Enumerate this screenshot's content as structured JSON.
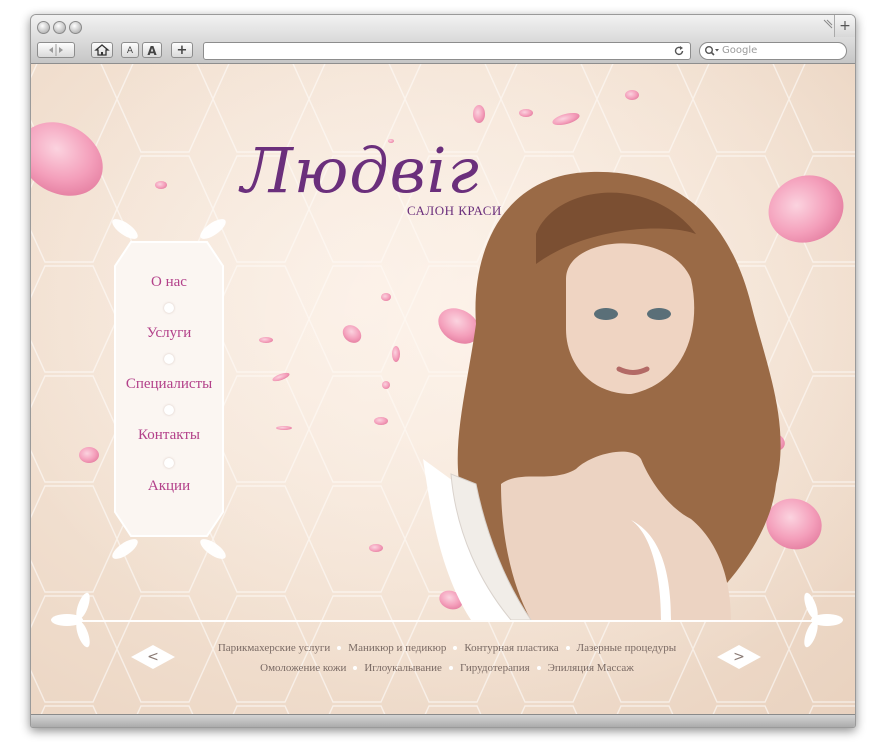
{
  "browser": {
    "search_placeholder": "Google",
    "text_smaller": "A",
    "text_larger": "A",
    "add_label": "+",
    "new_tab_label": "+"
  },
  "site": {
    "logo": "Людвіг",
    "subtitle": "САЛОН КРАСИ",
    "menu": [
      {
        "label": "О нас"
      },
      {
        "label": "Услуги"
      },
      {
        "label": "Специалисты"
      },
      {
        "label": "Контакты"
      },
      {
        "label": "Акции"
      }
    ],
    "footer_row1": [
      "Парикмахерские услуги",
      "Маникюр и педикюр",
      "Контурная пластика",
      "Лазерные процедуры"
    ],
    "footer_row2": [
      "Омоложение кожи",
      "Иглоукалывание",
      "Гирудотерапия",
      "Эпиляция Массаж"
    ],
    "prev_label": "<",
    "next_label": ">"
  },
  "colors": {
    "accent": "#6b2f7c",
    "menu_text": "#b3418a",
    "background": "#f1dfcf",
    "petal": "#f4a0bb"
  }
}
